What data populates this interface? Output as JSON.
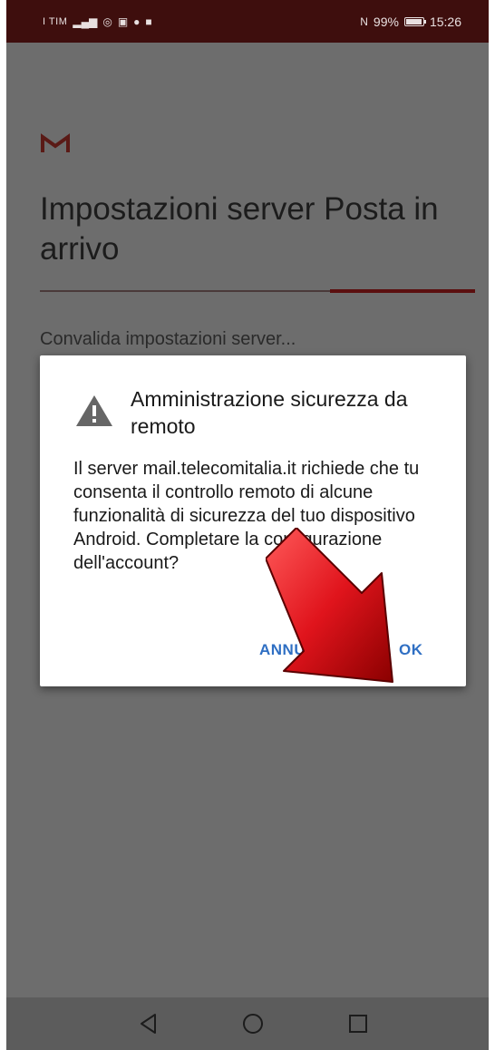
{
  "status_bar": {
    "carrier": "I TIM",
    "battery_text": "99%",
    "time": "15:26"
  },
  "app": {
    "logo": "gmail-logo",
    "page_title": "Impostazioni server Posta in arrivo",
    "status_text": "Convalida impostazioni server..."
  },
  "dialog": {
    "icon": "warning-icon",
    "title": "Amministrazione sicurezza da remoto",
    "message": "Il server mail.telecomitalia.it richiede che tu consenta il controllo remoto di alcune funzionalità di sicurezza del tuo dispositivo Android. Completare la configurazione dell'account?",
    "cancel_label": "ANNULLA",
    "ok_label": "OK"
  },
  "nav_bar": {
    "back": "back-triangle-icon",
    "home": "home-circle-icon",
    "recents": "recents-square-icon"
  },
  "colors": {
    "status_bar_bg": "#3e0e0d",
    "content_bg": "#6d6d6d",
    "accent_button": "#2f6fc3",
    "annotation_arrow": "#d0101a"
  }
}
